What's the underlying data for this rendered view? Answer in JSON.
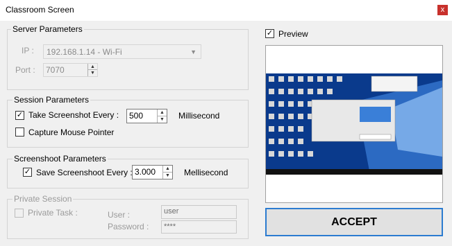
{
  "window": {
    "title": "Classroom Screen",
    "close_glyph": "x"
  },
  "server": {
    "legend": "Server Parameters",
    "ip_label": "IP :",
    "ip_value": "192.168.1.14 - Wi-Fi",
    "port_label": "Port :",
    "port_value": "7070"
  },
  "session": {
    "legend": "Session Parameters",
    "take_label": "Take Screenshot Every :",
    "take_checked": true,
    "take_value": "500",
    "take_unit": "Millisecond",
    "mouse_label": "Capture Mouse Pointer",
    "mouse_checked": false
  },
  "screenshot": {
    "legend": "Screenshoot Parameters",
    "save_label": "Save Screenshoot Every :",
    "save_checked": true,
    "save_value": "3.000",
    "save_unit": "Mellisecond"
  },
  "private": {
    "legend": "Private Session",
    "task_label": "Private Task :",
    "user_label": "User :",
    "user_value": "user",
    "password_label": "Password :",
    "password_value": "****"
  },
  "preview": {
    "label": "Preview",
    "checked": true
  },
  "accept_label": "ACCEPT",
  "check_glyph": "✓",
  "colors": {
    "accent": "#2b7bd0",
    "close": "#c8312c",
    "desktop": "#0a3a8c"
  }
}
